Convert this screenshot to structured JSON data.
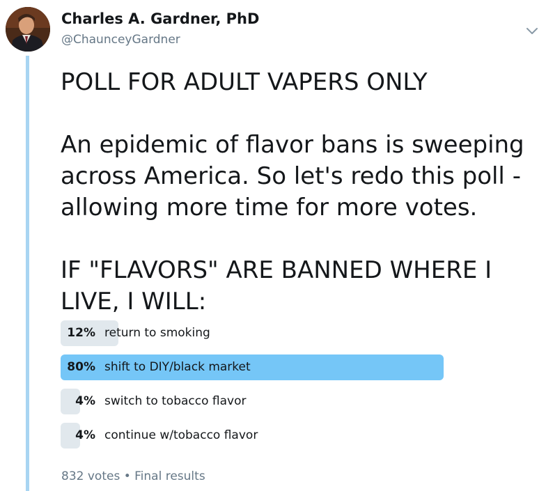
{
  "author": {
    "display_name": "Charles A. Gardner, PhD",
    "handle": "@ChaunceyGardner"
  },
  "tweet": {
    "line1": "POLL FOR ADULT VAPERS ONLY",
    "line2": "An epidemic of flavor bans is sweeping",
    "line3": "across America.  So let's redo this poll -",
    "line4": "allowing more time for more votes.",
    "line5": "IF \"FLAVORS\" ARE BANNED WHERE I",
    "line6": "LIVE, I WILL:"
  },
  "poll": {
    "choices": [
      {
        "percent_label": "12%",
        "label": "return to smoking",
        "percent": 12
      },
      {
        "percent_label": "80%",
        "label": "shift to DIY/black market",
        "percent": 80
      },
      {
        "percent_label": "4%",
        "label": "switch to tobacco flavor",
        "percent": 4
      },
      {
        "percent_label": "4%",
        "label": "continue w/tobacco flavor",
        "percent": 4
      }
    ],
    "votes": "832 votes",
    "separator": "•",
    "status": "Final results"
  },
  "colors": {
    "winner_bar": "#75c6f7",
    "other_bar": "#e1e8ed",
    "thread_line": "#a8d5f2",
    "secondary_text": "#657786"
  },
  "icons": {
    "caret": "chevron-down-icon",
    "avatar": "profile-photo"
  }
}
